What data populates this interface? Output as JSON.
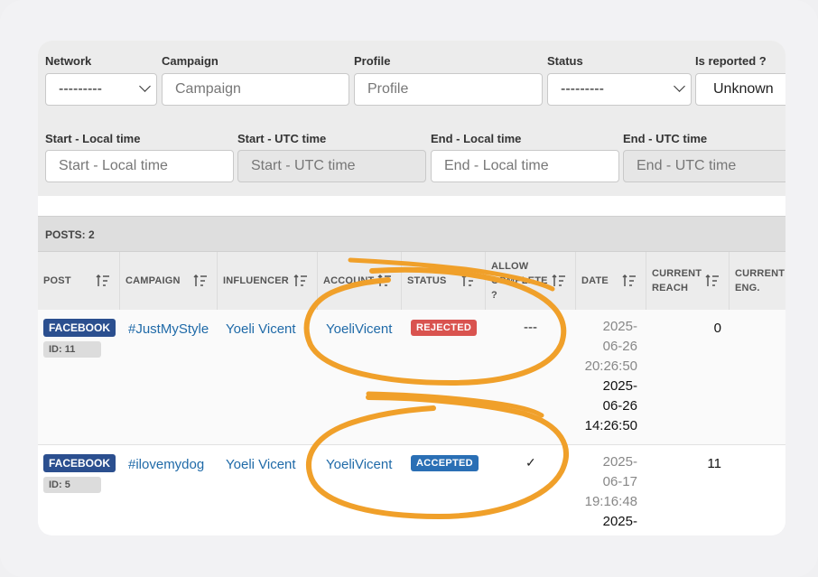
{
  "filters": {
    "row1": [
      {
        "label": "Network",
        "value": "---------",
        "type": "select"
      },
      {
        "label": "Campaign",
        "placeholder": "Campaign",
        "type": "input"
      },
      {
        "label": "Profile",
        "placeholder": "Profile",
        "type": "input"
      },
      {
        "label": "Status",
        "value": "---------",
        "type": "select"
      },
      {
        "label": "Is reported ?",
        "value": "Unknown",
        "type": "select"
      }
    ],
    "row2": [
      {
        "label": "Start - Local time",
        "placeholder": "Start - Local time"
      },
      {
        "label": "Start - UTC time",
        "placeholder": "Start - UTC time"
      },
      {
        "label": "End - Local time",
        "placeholder": "End - Local time"
      },
      {
        "label": "End - UTC time",
        "placeholder": "End - UTC time"
      }
    ]
  },
  "posts_count_label": "POSTS: 2",
  "columns": [
    "POST",
    "CAMPAIGN",
    "INFLUENCER",
    "ACCOUNT",
    "STATUS",
    "ALLOW COMPLETE ?",
    "DATE",
    "CURRENT REACH",
    "CURRENT ENG."
  ],
  "column_lines": {
    "allow": [
      "ALLOW",
      "COMPLETE",
      "?"
    ],
    "reach": [
      "CURRENT",
      "REACH"
    ],
    "eng": [
      "CURRENT",
      "ENG."
    ]
  },
  "rows": [
    {
      "network": "FACEBOOK",
      "id_label": "ID: 11",
      "campaign": "#JustMyStyle",
      "influencer": "Yoeli Vicent",
      "account": "YoeliVicent",
      "status": "REJECTED",
      "allow_complete": "---",
      "date_local": [
        "2025-",
        "06-26",
        "20:26:50"
      ],
      "date_utc": [
        "2025-",
        "06-26",
        "14:26:50"
      ],
      "reach": "0"
    },
    {
      "network": "FACEBOOK",
      "id_label": "ID: 5",
      "campaign": "#ilovemydog",
      "influencer": "Yoeli Vicent",
      "account": "YoeliVicent",
      "status": "ACCEPTED",
      "allow_complete": "✓",
      "date_local": [
        "2025-",
        "06-17",
        "19:16:48"
      ],
      "date_utc": [
        "2025-"
      ],
      "reach": "11"
    }
  ],
  "colors": {
    "rejected": "#d9534f",
    "accepted": "#2a6fb5",
    "facebook": "#2b4f8f",
    "link": "#1f6aa8",
    "highlight": "#f0a02a"
  },
  "icons": [
    "chevron-down-icon",
    "sort-icon",
    "checkmark-icon"
  ]
}
